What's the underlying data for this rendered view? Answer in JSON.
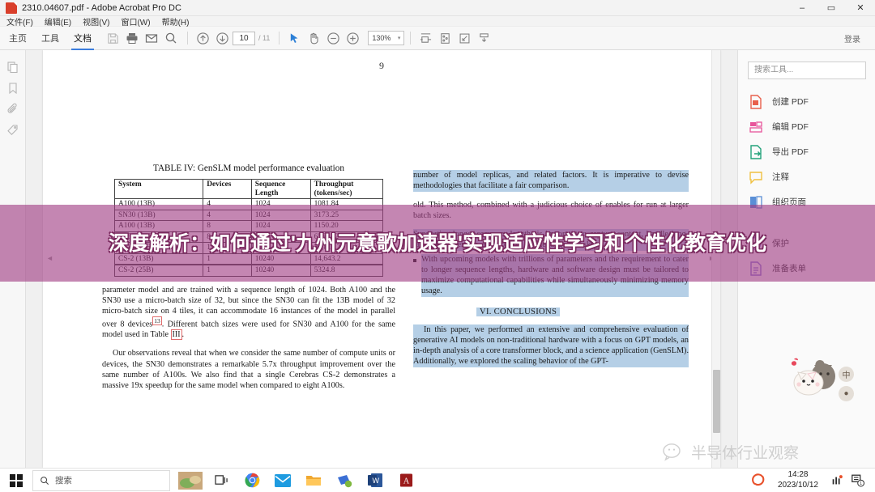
{
  "window": {
    "title": "2310.04607.pdf - Adobe Acrobat Pro DC",
    "app_icon": "pdf-file-icon",
    "minimize": "–",
    "maximize": "▭",
    "close": "✕"
  },
  "menubar": {
    "items": [
      {
        "label": "文件(F)",
        "name": "menu-file"
      },
      {
        "label": "编辑(E)",
        "name": "menu-edit"
      },
      {
        "label": "视图(V)",
        "name": "menu-view"
      },
      {
        "label": "窗口(W)",
        "name": "menu-window"
      },
      {
        "label": "帮助(H)",
        "name": "menu-help"
      }
    ]
  },
  "toolbar": {
    "tabs": [
      {
        "label": "主页",
        "active": false
      },
      {
        "label": "工具",
        "active": false
      },
      {
        "label": "文档",
        "active": true
      }
    ],
    "page_current": "10",
    "page_total": "/ 11",
    "zoom_level": "130%",
    "zoom_caret": "▾",
    "login_label": "登录",
    "icons": [
      "save-icon",
      "print-icon",
      "email-icon",
      "search-icon",
      "previous-page-icon",
      "next-page-icon",
      "select-cursor-icon",
      "hand-tool-icon",
      "zoom-out-icon",
      "zoom-in-icon",
      "fit-width-icon",
      "page-snapshot-icon",
      "fullscreen-icon",
      "scroll-mode-icon"
    ]
  },
  "left_rail": {
    "icons": [
      "page-thumbnails-icon",
      "bookmarks-icon",
      "attachments-icon",
      "tags-icon"
    ]
  },
  "document": {
    "page_label": "9",
    "collapse_left": "◄",
    "collapse_right": "►",
    "table": {
      "caption": "TABLE IV: GenSLM model performance evaluation",
      "headers": [
        "System",
        "Devices",
        "Sequence Length",
        "Throughput (tokens/sec)"
      ],
      "rows": [
        [
          "A100 (13B)",
          "4",
          "1024",
          "1081.84"
        ],
        [
          "SN30 (13B)",
          "4",
          "1024",
          "3173.25"
        ],
        [
          "A100 (13B)",
          "8",
          "1024",
          "1150.20"
        ],
        [
          "SN30 (13B)",
          "8",
          "1024",
          "6561.22"
        ],
        [
          "CS-2 (13B)",
          "1",
          "1024",
          "21,811.2"
        ],
        [
          "CS-2 (13B)",
          "1",
          "10240",
          "14,643.2"
        ]
      ],
      "last_row": [
        "CS-2 (25B)",
        "1",
        "10240",
        "5324.8"
      ]
    },
    "left_column": {
      "para1_a": "parameter model and are trained with a sequence length of 1024. Both A100 and the SN30 use a micro-batch size of 32, but since the SN30 can fit the 13B model of 32 micro-batch size on 4 tiles, it can accommodate 16 instances of the model in parallel over 8 devices",
      "para1_ref": "13",
      "para1_b": ". Different batch sizes were used for SN30 and A100 for the same model used in Table ",
      "para1_ref2": "III",
      "para1_c": ".",
      "para2": "Our observations reveal that when we consider the same number of compute units or devices, the SN30 demonstrates a remarkable 5.7x throughput improvement over the same number of A100s. We also find that a single Cerebras CS-2 demonstrates a massive 19x speedup for the same model when compared to eight A100s."
    },
    "right_column": {
      "para1": "number of model replicas, and related factors. It is imperative to devise methodologies that facilitate a fair comparison.",
      "para2": "old. This method, combined with a judicious choice of enables for run at larger batch sizes.",
      "para3": "Supporting longer sequence lengths is important to capture context, handle long-range dependencies, and excel in a wide range of tasks.",
      "bullet1": "With upcoming models with trillions of parameters and the requirement to cater to longer sequence lengths, hardware and software design must be tailored to maximize computational capabilities while simultaneously minimizing memory usage.",
      "section_heading": "VI.  CONCLUSIONS",
      "conclusion": "In this paper, we performed an extensive and comprehensive evaluation of generative AI models on non-traditional hardware with a focus on GPT models, an in-depth analysis of a core transformer block, and a science application (GenSLM). Additionally, we explored the scaling behavior of the GPT-"
    }
  },
  "right_panel": {
    "search_placeholder": "搜索工具...",
    "tools": [
      {
        "label": "创建 PDF",
        "icon": "create-pdf-icon",
        "color": "#e8604c"
      },
      {
        "label": "编辑 PDF",
        "icon": "edit-pdf-icon",
        "color": "#e8559b"
      },
      {
        "label": "导出 PDF",
        "icon": "export-pdf-icon",
        "color": "#21a179"
      },
      {
        "label": "注释",
        "icon": "comment-icon",
        "color": "#f0c040"
      },
      {
        "label": "组织页面",
        "icon": "organize-pages-icon",
        "color": "#5a8fd6"
      },
      {
        "label": "保护",
        "icon": "protect-shield-icon",
        "color": "#8a76d4"
      },
      {
        "label": "准备表单",
        "icon": "prepare-form-icon",
        "color": "#8a76d4"
      }
    ]
  },
  "overlay": {
    "text": "深度解析：如何通过'九州元意歌加速器'实现适应性学习和个性化教育优化",
    "bg_color": "#a03c82"
  },
  "watermark": {
    "text": "半导体行业观察",
    "logo": "wechat-icon"
  },
  "ime": {
    "badges": [
      "中",
      "●"
    ]
  },
  "taskbar": {
    "start": "windows-start-icon",
    "search_placeholder": "搜索",
    "items": [
      "task-view-icon",
      "chrome-icon",
      "mail-icon",
      "file-explorer-icon",
      "sticky-notes-icon",
      "word-icon",
      "acrobat-icon"
    ],
    "tray_icon": "sogou-icon",
    "time": "14:28",
    "date": "2023/10/12",
    "tray_extra": [
      "volume-icon",
      "notifications-icon"
    ],
    "notification_count": "1"
  }
}
